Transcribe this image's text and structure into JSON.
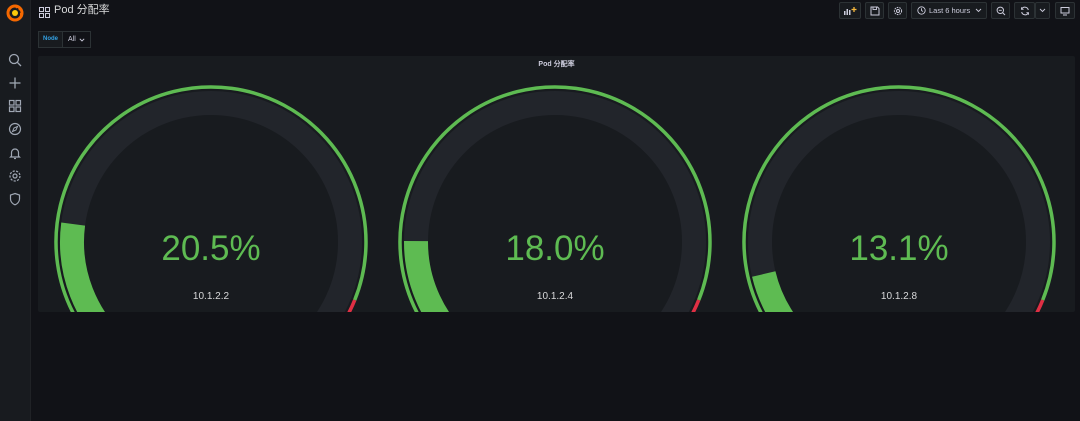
{
  "dashboard": {
    "title": "Pod 分配率"
  },
  "toolbar": {
    "time_range_label": "Last 6 hours"
  },
  "variables": [
    {
      "label": "Node",
      "value": "All"
    }
  ],
  "panel": {
    "title": "Pod 分配率",
    "gauges": [
      {
        "value": 20.5,
        "display": "20.5%",
        "label": "10.1.2.2"
      },
      {
        "value": 18.0,
        "display": "18.0%",
        "label": "10.1.2.4"
      },
      {
        "value": 13.1,
        "display": "13.1%",
        "label": "10.1.2.8"
      }
    ],
    "thresholds": [
      {
        "from": 0,
        "color": "#5ebb52"
      },
      {
        "from": 90,
        "color": "#e02f44"
      }
    ],
    "min": 0,
    "max": 100
  },
  "colors": {
    "gauge_fill": "#5ebb52",
    "gauge_track": "#22252b",
    "threshold_green": "#5ebb52",
    "threshold_red": "#e02f44",
    "accent": "#33a2e5"
  }
}
